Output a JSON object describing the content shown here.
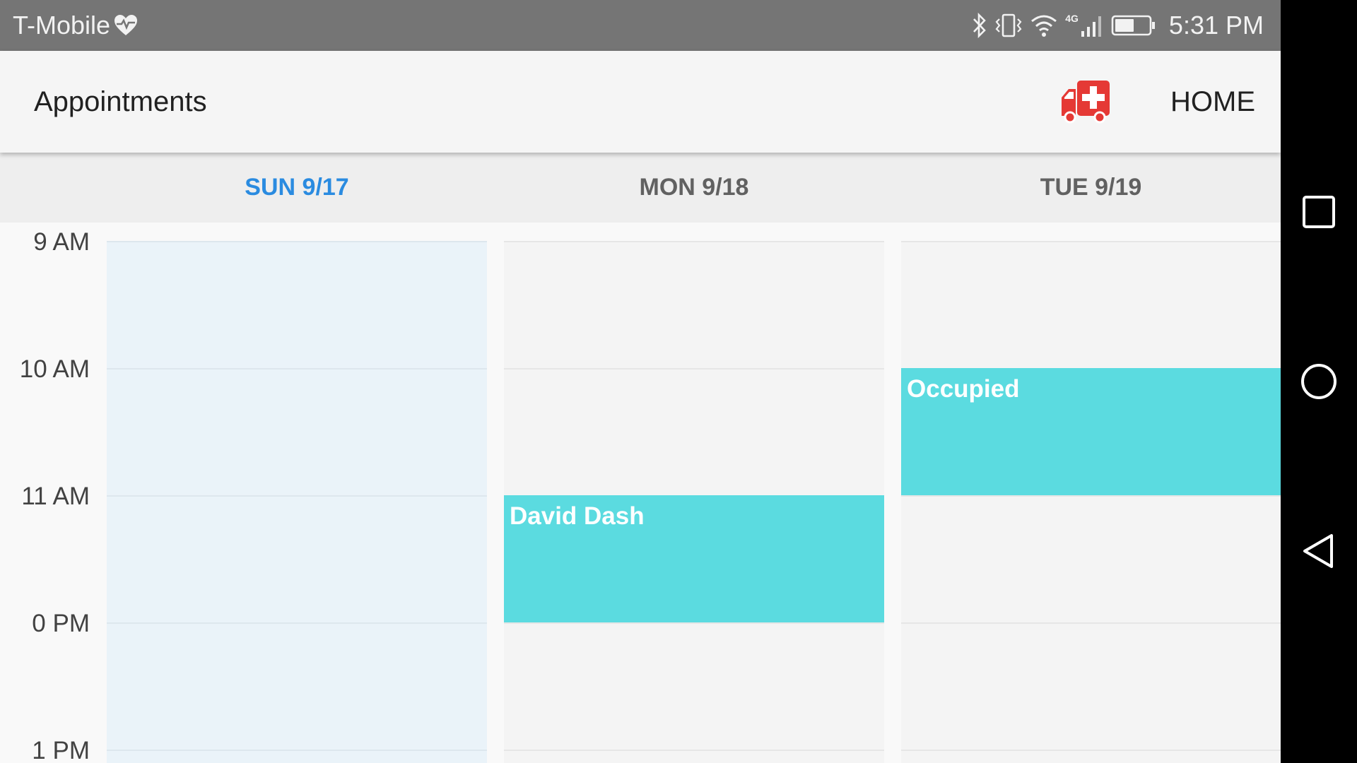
{
  "status_bar": {
    "carrier": "T-Mobile",
    "network": "4G",
    "time": "5:31 PM"
  },
  "app_bar": {
    "title": "Appointments",
    "home_label": "HOME",
    "emergency_icon": "ambulance-icon",
    "emergency_icon_color": "#e53935"
  },
  "days": [
    {
      "label": "SUN 9/17",
      "active": true
    },
    {
      "label": "MON 9/18",
      "active": false
    },
    {
      "label": "TUE 9/19",
      "active": false
    }
  ],
  "hours": [
    "9 AM",
    "10 AM",
    "11 AM",
    "0 PM",
    "1 PM"
  ],
  "events": [
    {
      "day": "MON 9/18",
      "title": "David Dash",
      "start": "11 AM",
      "end": "0 PM"
    },
    {
      "day": "TUE 9/19",
      "title": "Occupied",
      "start": "10 AM",
      "end": "11 AM"
    }
  ],
  "colors": {
    "accent": "#2a8be0",
    "event": "#5bdbe0",
    "today_column": "#eaf3f9",
    "status_bar": "#757575"
  },
  "nav_bar": {
    "icons": [
      "recents-icon",
      "home-circle-icon",
      "back-icon"
    ]
  }
}
